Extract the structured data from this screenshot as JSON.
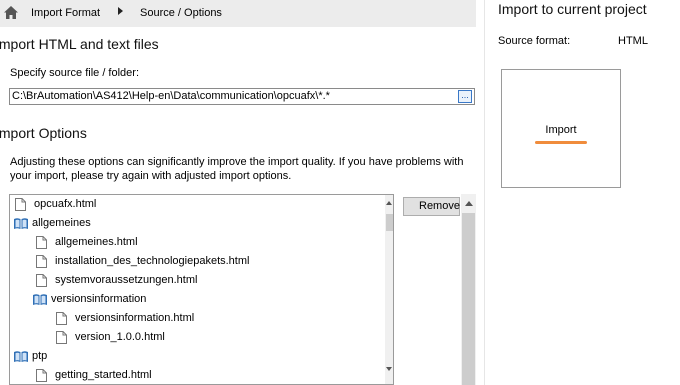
{
  "breadcrumb": {
    "step1": "Import Format",
    "step2": "Source / Options"
  },
  "import_section": {
    "title": "Import HTML and text files",
    "source_label": "Specify source file / folder:",
    "source_value": "C:\\BrAutomation\\AS412\\Help-en\\Data\\communication\\opcuafx\\*.*",
    "browse_label": "..."
  },
  "options_section": {
    "title": "Import Options",
    "description": "Adjusting these options can significantly improve the import quality. If you have problems with your import, please try again with adjusted import options."
  },
  "tree": {
    "items": [
      {
        "label": "opcuafx.html",
        "type": "file",
        "level": 0
      },
      {
        "label": "allgemeines",
        "type": "book",
        "level": 0
      },
      {
        "label": "allgemeines.html",
        "type": "file",
        "level": 1
      },
      {
        "label": "installation_des_technologiepakets.html",
        "type": "file",
        "level": 1
      },
      {
        "label": "systemvoraussetzungen.html",
        "type": "file",
        "level": 1
      },
      {
        "label": "versionsinformation",
        "type": "book",
        "level": 1
      },
      {
        "label": "versionsinformation.html",
        "type": "file",
        "level": 2
      },
      {
        "label": "version_1.0.0.html",
        "type": "file",
        "level": 2
      },
      {
        "label": "ptp",
        "type": "book",
        "level": 0
      },
      {
        "label": "getting_started.html",
        "type": "file",
        "level": 1
      }
    ]
  },
  "actions": {
    "remove_label": "Remove"
  },
  "project": {
    "title": "Import to current project",
    "source_format_label": "Source format:",
    "source_format_value": "HTML",
    "import_label": "Import"
  },
  "colors": {
    "accent_underline": "#f08c3c",
    "book_icon": "#2f6fb5",
    "breadcrumb_bg": "#ececec"
  },
  "icons": {
    "home": "home-icon",
    "chevron": "chevron-right-icon",
    "file": "file-icon",
    "book": "book-icon"
  }
}
